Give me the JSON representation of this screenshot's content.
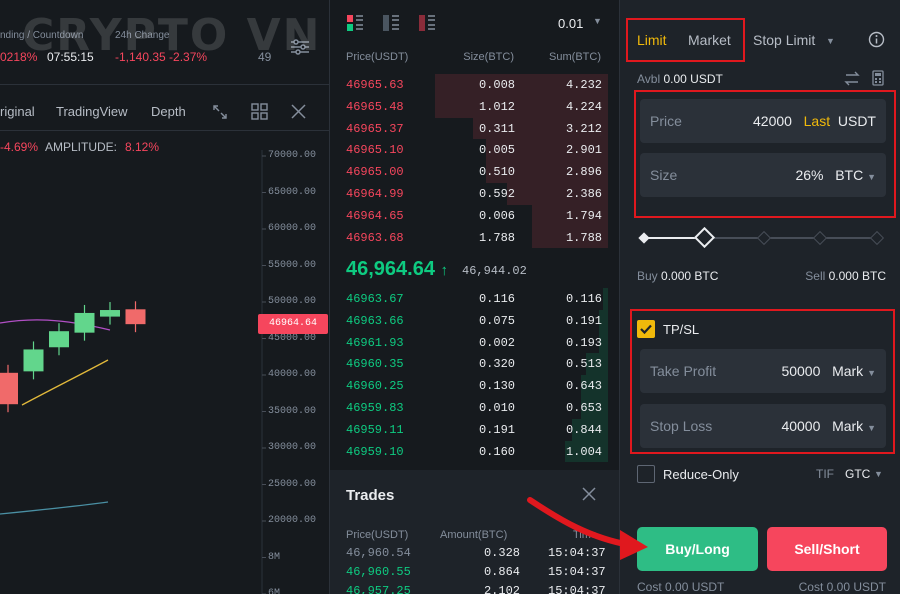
{
  "watermark": "CRYPTO VN",
  "ticker": {
    "funding_label": "nding / Countdown",
    "change_label": "24h Change",
    "funding_rate": "0218%",
    "countdown": "07:55:15",
    "change_value": "-1,140.35 -2.37%",
    "extra_value": "49"
  },
  "chart_tabs": {
    "original": "riginal",
    "tradingview": "TradingView",
    "depth": "Depth"
  },
  "chart_info": {
    "change": "-4.69%",
    "amplitude_label": "AMPLITUDE:",
    "amplitude_value": "8.12%"
  },
  "price_axis": [
    "70000.00",
    "65000.00",
    "60000.00",
    "55000.00",
    "50000.00",
    "45000.00",
    "40000.00",
    "35000.00",
    "30000.00",
    "25000.00",
    "20000.00",
    "8M",
    "6M"
  ],
  "current_price_tag": "46964.64",
  "candles": [
    {
      "open": 40300,
      "close": 36000
    },
    {
      "open": 40500,
      "close": 43500
    },
    {
      "open": 43800,
      "close": 46000
    },
    {
      "open": 45800,
      "close": 48500
    },
    {
      "open": 48000,
      "close": 48900
    },
    {
      "open": 49000,
      "close": 46964
    }
  ],
  "orderbook": {
    "tick": "0.01",
    "headers": {
      "price": "Price(USDT)",
      "size": "Size(BTC)",
      "sum": "Sum(BTC)"
    },
    "asks": [
      {
        "price": "46965.63",
        "size": "0.008",
        "sum": "4.232",
        "depth": 0.96
      },
      {
        "price": "46965.48",
        "size": "1.012",
        "sum": "4.224",
        "depth": 0.96
      },
      {
        "price": "46965.37",
        "size": "0.311",
        "sum": "3.212",
        "depth": 0.75
      },
      {
        "price": "46965.10",
        "size": "0.005",
        "sum": "2.901",
        "depth": 0.68
      },
      {
        "price": "46965.00",
        "size": "0.510",
        "sum": "2.896",
        "depth": 0.68
      },
      {
        "price": "46964.99",
        "size": "0.592",
        "sum": "2.386",
        "depth": 0.56
      },
      {
        "price": "46964.65",
        "size": "0.006",
        "sum": "1.794",
        "depth": 0.42
      },
      {
        "price": "46963.68",
        "size": "1.788",
        "sum": "1.788",
        "depth": 0.42
      }
    ],
    "last_price": "46,964.64",
    "mark_price": "46,944.02",
    "bids": [
      {
        "price": "46963.67",
        "size": "0.116",
        "sum": "0.116",
        "depth": 0.03
      },
      {
        "price": "46963.66",
        "size": "0.075",
        "sum": "0.191",
        "depth": 0.05
      },
      {
        "price": "46961.93",
        "size": "0.002",
        "sum": "0.193",
        "depth": 0.05
      },
      {
        "price": "46960.35",
        "size": "0.320",
        "sum": "0.513",
        "depth": 0.12
      },
      {
        "price": "46960.25",
        "size": "0.130",
        "sum": "0.643",
        "depth": 0.15
      },
      {
        "price": "46959.83",
        "size": "0.010",
        "sum": "0.653",
        "depth": 0.15
      },
      {
        "price": "46959.11",
        "size": "0.191",
        "sum": "0.844",
        "depth": 0.2
      },
      {
        "price": "46959.10",
        "size": "0.160",
        "sum": "1.004",
        "depth": 0.24
      }
    ]
  },
  "trades": {
    "title": "Trades",
    "headers": {
      "price": "Price(USDT)",
      "amount": "Amount(BTC)",
      "time": "Time"
    },
    "rows": [
      {
        "price": "46,960.54",
        "amount": "0.328",
        "time": "15:04:37"
      },
      {
        "price": "46,960.55",
        "amount": "0.864",
        "time": "15:04:37"
      },
      {
        "price": "46,957.25",
        "amount": "2.102",
        "time": "15:04:37"
      }
    ]
  },
  "order_form": {
    "tabs": {
      "limit": "Limit",
      "market": "Market",
      "stop_limit": "Stop Limit"
    },
    "avbl_label": "Avbl",
    "avbl_value": "0.00 USDT",
    "price": {
      "label": "Price",
      "value": "42000",
      "tag": "Last",
      "unit": "USDT"
    },
    "size": {
      "label": "Size",
      "value": "26%",
      "unit": "BTC"
    },
    "slider_fraction": 0.26,
    "buy_label": "Buy",
    "buy_value": "0.000 BTC",
    "sell_label": "Sell",
    "sell_value": "0.000 BTC",
    "tpsl_label": "TP/SL",
    "take_profit": {
      "label": "Take Profit",
      "value": "50000",
      "unit": "Mark"
    },
    "stop_loss": {
      "label": "Stop Loss",
      "value": "40000",
      "unit": "Mark"
    },
    "reduce_only": "Reduce-Only",
    "tif_label": "TIF",
    "tif_value": "GTC",
    "buy_button": "Buy/Long",
    "sell_button": "Sell/Short",
    "cost_buy": "Cost 0.00 USDT",
    "cost_sell": "Cost 0.00 USDT"
  },
  "colors": {
    "up": "#0ecb81",
    "down": "#f6465d",
    "accent": "#f0b90b",
    "annotation": "#e0181e"
  }
}
